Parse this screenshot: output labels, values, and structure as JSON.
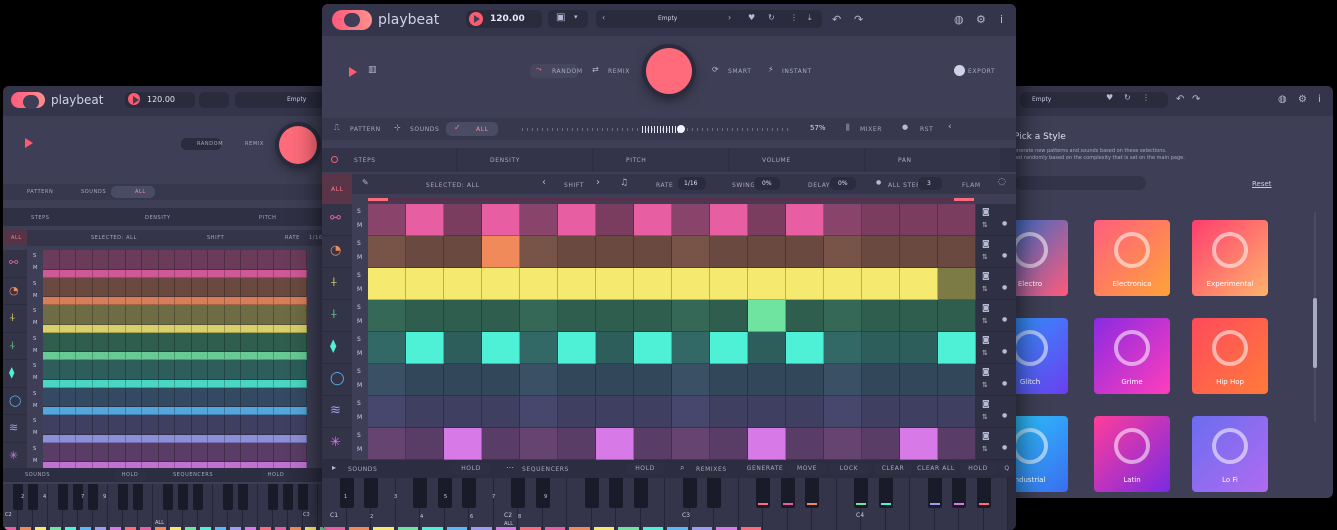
{
  "app": {
    "name": "playbeat",
    "tempo": "120.00",
    "preset": "Empty",
    "export_label": "EXPORT"
  },
  "modes": {
    "random": "RANDOM",
    "remix": "REMIX",
    "smart": "SMART",
    "instant": "INSTANT"
  },
  "edit": {
    "pattern": "PATTERN",
    "sounds": "SOUNDS",
    "all": "ALL",
    "complexity": "57%",
    "mixer": "MIXER",
    "rst": "RST"
  },
  "tabs": {
    "steps": "STEPS",
    "density": "DENSITY",
    "pitch": "PITCH",
    "volume": "VOLUME",
    "pan": "PAN"
  },
  "seqbar": {
    "all": "ALL",
    "selected": "Selected: ALL",
    "shift": "SHIFT",
    "rate": "RATE",
    "rate_value": "1/16",
    "swing": "SWING",
    "swing_value": "0%",
    "delay": "DELAY",
    "delay_value": "0%",
    "all_steps": "ALL STEPS",
    "all_steps_value": "3",
    "flam": "FLAM"
  },
  "bottom": {
    "sounds": "SOUNDS",
    "hold": "HOLD",
    "sequencers": "SEQUENCERS",
    "remixes": "REMIXES",
    "buttons": [
      "GENERATE",
      "MOVE",
      "LOCK",
      "CLEAR",
      "CLEAR ALL",
      "HOLD"
    ],
    "q": "Q"
  },
  "keys": {
    "c1": "C1",
    "c2": "C2",
    "c3": "C3",
    "c4": "C4",
    "all": "ALL",
    "nums": [
      "1",
      "2",
      "3",
      "4",
      "5",
      "6",
      "7",
      "8",
      "9"
    ]
  },
  "rowlabels": {
    "s": "S",
    "m": "M"
  },
  "left_keys": {
    "nums": [
      "2",
      "4",
      "7",
      "9"
    ],
    "c2": "C2",
    "c3": "C3",
    "all": "ALL"
  },
  "right_panel": {
    "title": "Pick a Style",
    "desc1": "enerate new patterns and sounds based on these selections.",
    "desc2": "ted randomly based on the complexity that is set on the main page.",
    "reset": "Reset",
    "styles": [
      "Electro",
      "Electronica",
      "Experimental",
      "Glitch",
      "Grime",
      "Hip Hop",
      "ndustrial",
      "Latin",
      "Lo Fi"
    ]
  },
  "colors": {
    "accent": "#ff6b7a",
    "pink": "#e85ea3",
    "orange": "#f08a5a",
    "yellow": "#f5ea6f",
    "green": "#6fe3a0",
    "cyan": "#4ef0d6",
    "violet": "#d77ae8"
  }
}
